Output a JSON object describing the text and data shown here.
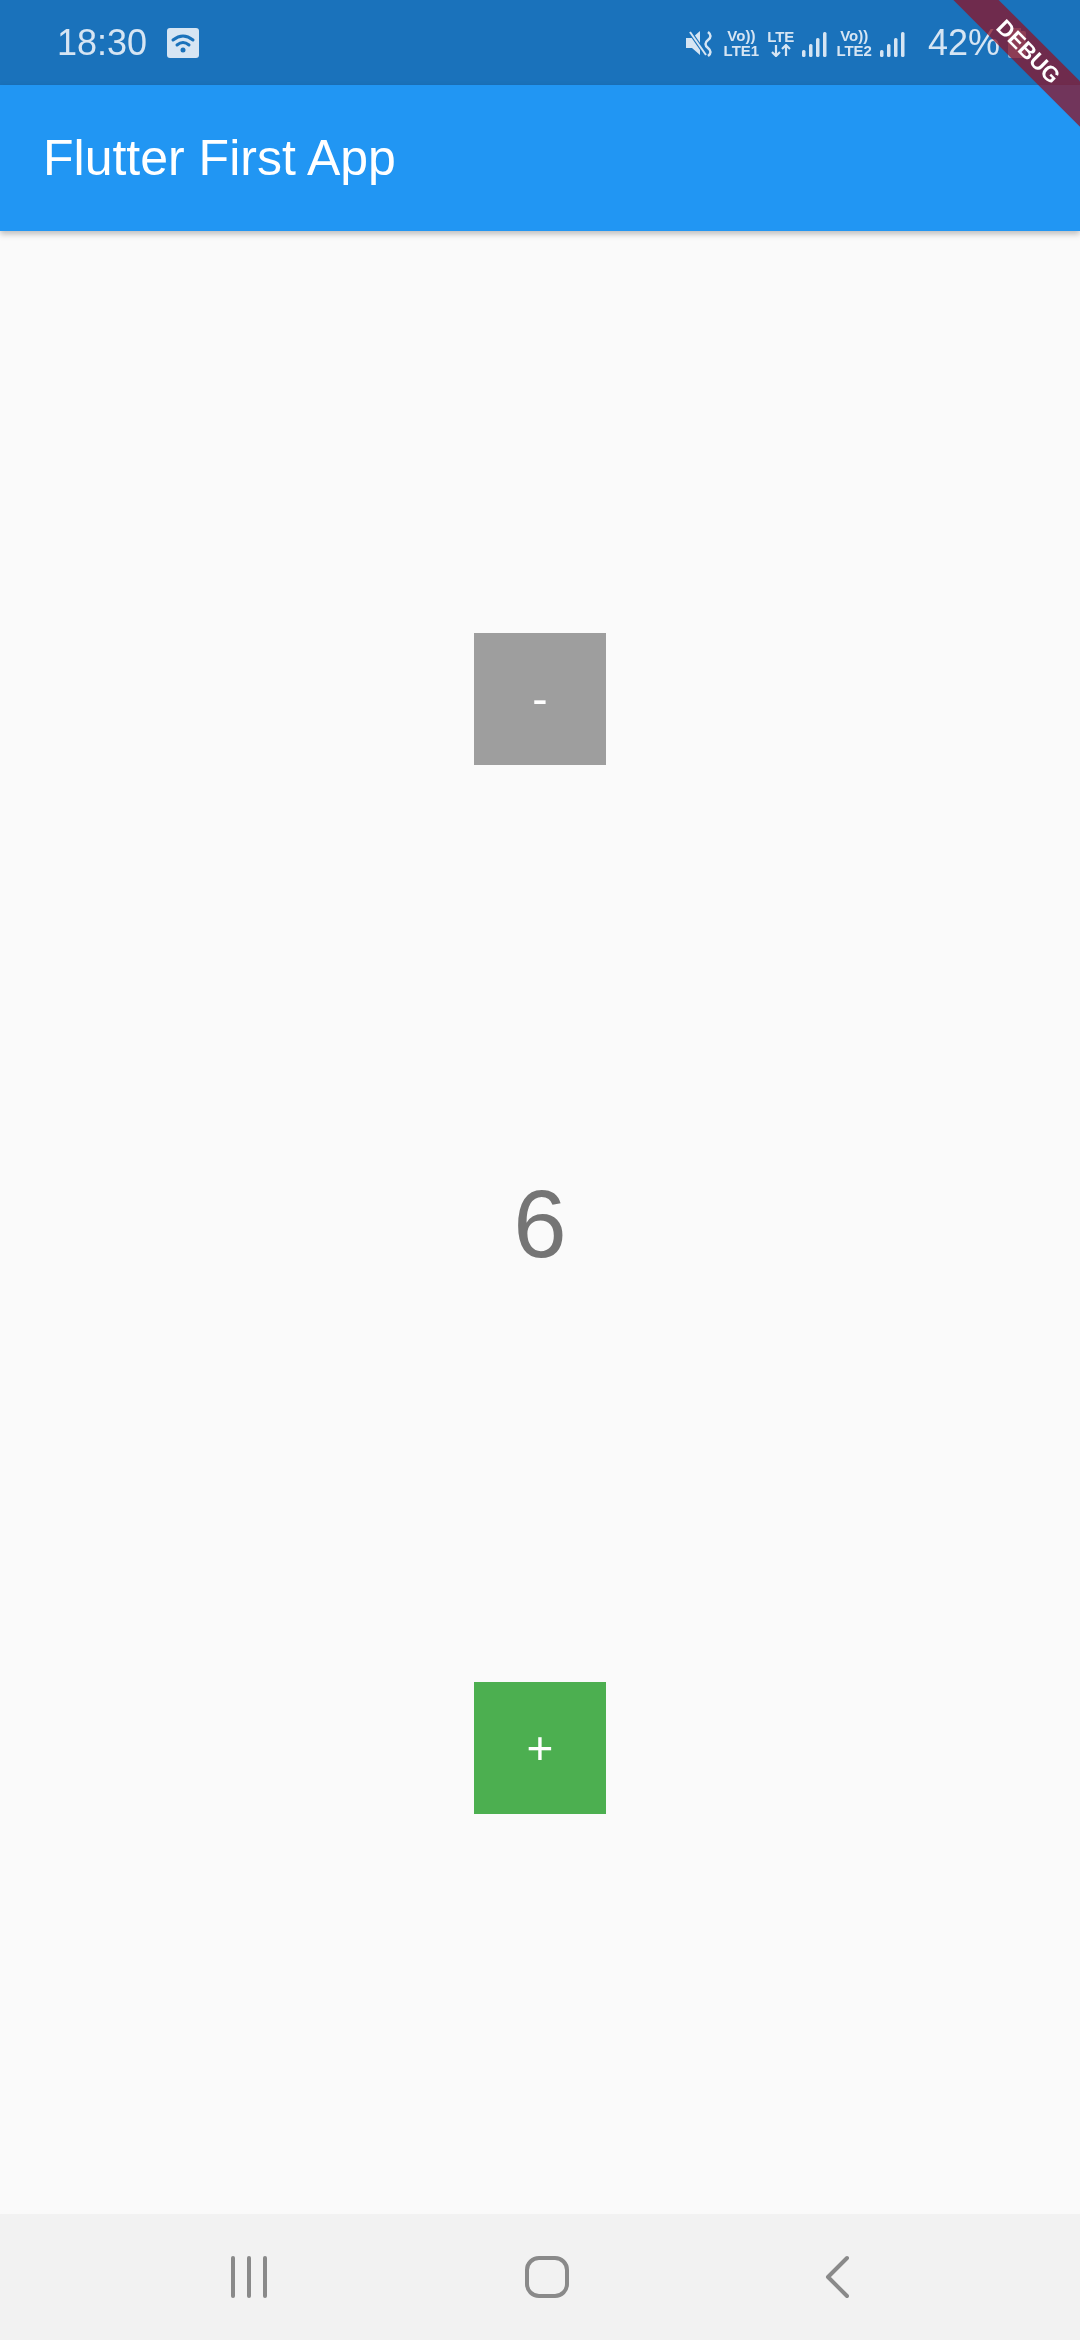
{
  "status_bar": {
    "time": "18:30",
    "indicators": [
      {
        "kind": "mute"
      },
      {
        "kind": "volte",
        "top": "Vo))",
        "bottom": "LTE1"
      },
      {
        "kind": "data",
        "top": "LTE"
      },
      {
        "kind": "signal"
      },
      {
        "kind": "volte",
        "top": "Vo))",
        "bottom": "LTE2"
      },
      {
        "kind": "signal"
      }
    ],
    "battery": "42%"
  },
  "app_bar": {
    "title": "Flutter First App"
  },
  "counter": {
    "decrement": {
      "label": "-",
      "color": "#9e9e9e"
    },
    "value": "6",
    "increment": {
      "label": "+",
      "color": "#4caf50"
    }
  },
  "debug_banner": {
    "label": "DEBUG"
  }
}
